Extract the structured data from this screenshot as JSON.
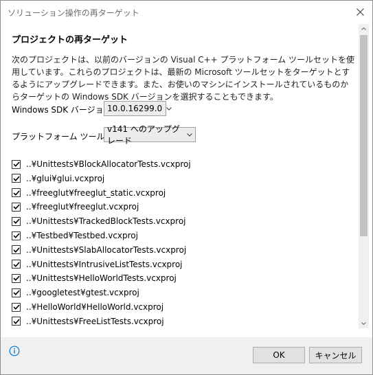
{
  "window": {
    "title": "ソリューション操作の再ターゲット"
  },
  "heading": "プロジェクトの再ターゲット",
  "description": "次のプロジェクトは、以前のバージョンの Visual C++ プラットフォーム ツールセットを使用しています。これらのプロジェクトは、最新の Microsoft ツールセットをターゲットとするようにアップグレードできます。また、お使いのマシンにインストールされているものからターゲットの Windows SDK バージョンを選択することもできます。",
  "sdk": {
    "label": "Windows SDK バージョン:",
    "value": "10.0.16299.0"
  },
  "toolset": {
    "label": "プラットフォーム ツールセット:",
    "value": "v141 へのアップグレード"
  },
  "projects": [
    {
      "path": "..¥Unittests¥BlockAllocatorTests.vcxproj",
      "checked": true
    },
    {
      "path": "..¥glui¥glui.vcxproj",
      "checked": true
    },
    {
      "path": "..¥freeglut¥freeglut_static.vcxproj",
      "checked": true
    },
    {
      "path": "..¥freeglut¥freeglut.vcxproj",
      "checked": true
    },
    {
      "path": "..¥Unittests¥TrackedBlockTests.vcxproj",
      "checked": true
    },
    {
      "path": "..¥Testbed¥Testbed.vcxproj",
      "checked": true
    },
    {
      "path": "..¥Unittests¥SlabAllocatorTests.vcxproj",
      "checked": true
    },
    {
      "path": "..¥Unittests¥IntrusiveListTests.vcxproj",
      "checked": true
    },
    {
      "path": "..¥Unittests¥HelloWorldTests.vcxproj",
      "checked": true
    },
    {
      "path": "..¥googletest¥gtest.vcxproj",
      "checked": true
    },
    {
      "path": "..¥HelloWorld¥HelloWorld.vcxproj",
      "checked": true
    },
    {
      "path": "..¥Unittests¥FreeListTests.vcxproj",
      "checked": true
    }
  ],
  "buttons": {
    "ok": "OK",
    "cancel": "キャンセル"
  },
  "colors": {
    "info": "#0078d7",
    "scroll_thumb": "#c2c2c2"
  }
}
